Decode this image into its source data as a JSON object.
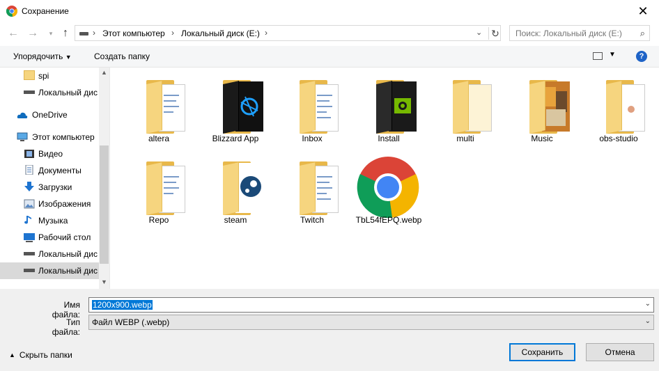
{
  "window": {
    "title": "Сохранение",
    "close_glyph": "✕"
  },
  "nav": {
    "breadcrumb": [
      "Этот компьютер",
      "Локальный диск (E:)"
    ],
    "search_placeholder": "Поиск: Локальный диск (E:)"
  },
  "toolbar": {
    "organize": "Упорядочить",
    "new_folder": "Создать папку"
  },
  "sidebar": {
    "items": [
      {
        "label": "spi",
        "icon": "folder-icon"
      },
      {
        "label": "Локальный дис",
        "icon": "drive-icon"
      },
      {
        "label": "OneDrive",
        "icon": "cloud-icon"
      },
      {
        "label": "Этот компьютер",
        "icon": "computer-icon"
      },
      {
        "label": "Видео",
        "icon": "video-icon"
      },
      {
        "label": "Документы",
        "icon": "documents-icon"
      },
      {
        "label": "Загрузки",
        "icon": "download-icon"
      },
      {
        "label": "Изображения",
        "icon": "pictures-icon"
      },
      {
        "label": "Музыка",
        "icon": "music-icon"
      },
      {
        "label": "Рабочий стол",
        "icon": "desktop-icon"
      },
      {
        "label": "Локальный дис",
        "icon": "drive-icon"
      },
      {
        "label": "Локальный дис",
        "icon": "drive-icon"
      }
    ]
  },
  "files": [
    {
      "name": "altera",
      "type": "folder"
    },
    {
      "name": "Blizzard App",
      "type": "folder-app"
    },
    {
      "name": "Inbox",
      "type": "folder"
    },
    {
      "name": "Install",
      "type": "folder-app"
    },
    {
      "name": "multi",
      "type": "folder"
    },
    {
      "name": "Music",
      "type": "folder-images"
    },
    {
      "name": "obs-studio",
      "type": "folder"
    },
    {
      "name": "Repo",
      "type": "folder"
    },
    {
      "name": "steam",
      "type": "folder-app"
    },
    {
      "name": "Twitch",
      "type": "folder"
    },
    {
      "name": "TbL54fEPQ.webp",
      "type": "image"
    }
  ],
  "form": {
    "filename_label": "Имя файла:",
    "filename_value": "1200x900.webp",
    "filetype_label": "Тип файла:",
    "filetype_value": "Файл WEBP (.webp)",
    "hide_folders": "Скрыть папки",
    "save": "Сохранить",
    "cancel": "Отмена"
  },
  "colors": {
    "accent": "#0078d7",
    "selection": "#cce8ff",
    "folder": "#f6d57f"
  }
}
